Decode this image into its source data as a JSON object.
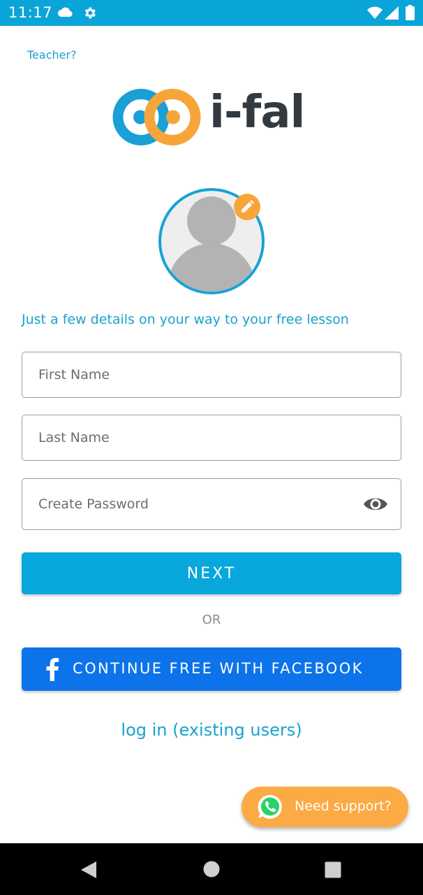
{
  "status_bar": {
    "time": "11:17",
    "icons": [
      "cloud-icon",
      "gear-icon",
      "wifi-icon",
      "signal-icon",
      "battery-icon"
    ]
  },
  "header": {
    "teacher_link": "Teacher?"
  },
  "logo": {
    "text": "i-fal",
    "colors": {
      "blue": "#1a9fd6",
      "orange": "#f7a53a",
      "text": "#333a3f"
    }
  },
  "avatar": {
    "edit_icon": "pencil-icon"
  },
  "form": {
    "tagline": "Just a few details on your way to your free lesson",
    "first_name": {
      "placeholder": "First Name",
      "value": ""
    },
    "last_name": {
      "placeholder": "Last Name",
      "value": ""
    },
    "password": {
      "placeholder": "Create Password",
      "value": "",
      "toggle_icon": "eye-icon"
    },
    "next_label": "NEXT",
    "or_label": "OR",
    "facebook_label": "CONTINUE FREE WITH FACEBOOK",
    "login_link": "log in (existing users)"
  },
  "support": {
    "label": "Need support?",
    "icon": "whatsapp-icon"
  },
  "nav_bar": {
    "icons": [
      "back-icon",
      "home-icon",
      "recents-icon"
    ]
  },
  "colors": {
    "accent": "#08a7dc",
    "facebook": "#0c73ea",
    "support": "#fbaa44",
    "link": "#1aa1cf"
  }
}
